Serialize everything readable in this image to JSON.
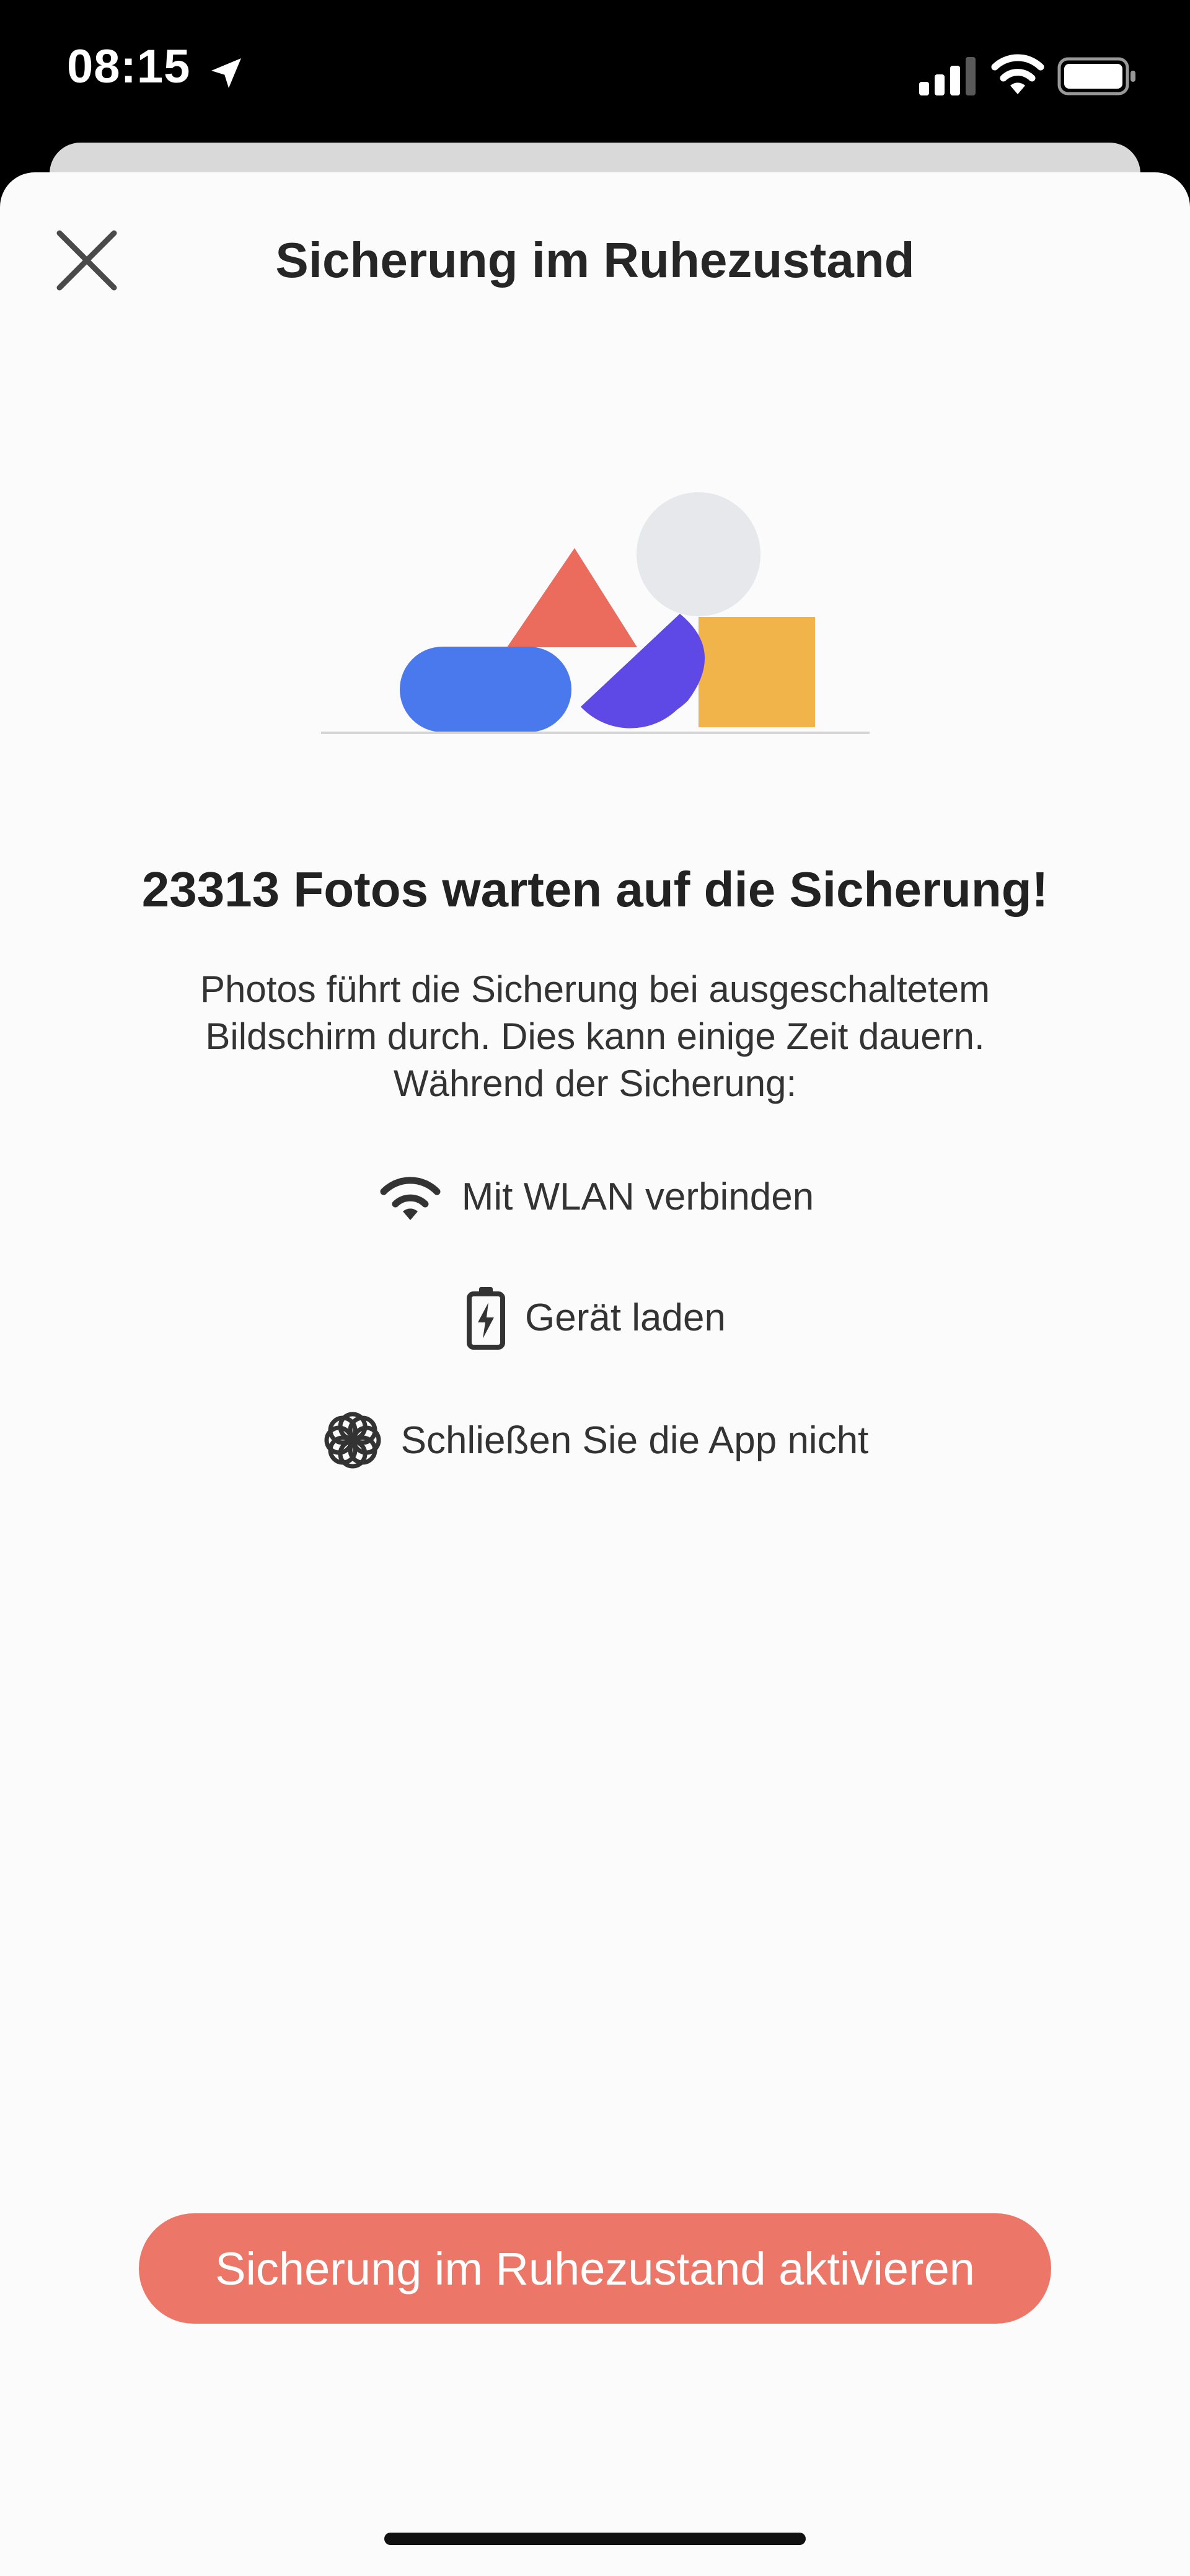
{
  "status_bar": {
    "time": "08:15",
    "icons": [
      "location-arrow-icon",
      "cellular-signal-icon",
      "wifi-icon",
      "battery-icon"
    ]
  },
  "header": {
    "title": "Sicherung im Ruhezustand",
    "close_icon": "close-icon"
  },
  "main": {
    "headline": "23313 Fotos warten auf die Sicherung!",
    "description": [
      "Photos führt die Sicherung bei ausgeschaltetem",
      "Bildschirm durch. Dies kann einige Zeit dauern.",
      "Während der Sicherung:"
    ],
    "tips": [
      {
        "icon": "wifi-icon",
        "label": "Mit WLAN verbinden"
      },
      {
        "icon": "battery-charging-icon",
        "label": "Gerät laden"
      },
      {
        "icon": "photos-app-icon",
        "label": "Schließen Sie die App nicht"
      }
    ]
  },
  "footer": {
    "cta_label": "Sicherung im Ruhezustand aktivieren"
  },
  "colors": {
    "accent": "#ec7768",
    "triangle": "#eb6b5c",
    "pill": "#4a79ee",
    "quarter_circle": "#5e48e6",
    "square": "#f1b44b",
    "circle": "#e6e8ec"
  }
}
